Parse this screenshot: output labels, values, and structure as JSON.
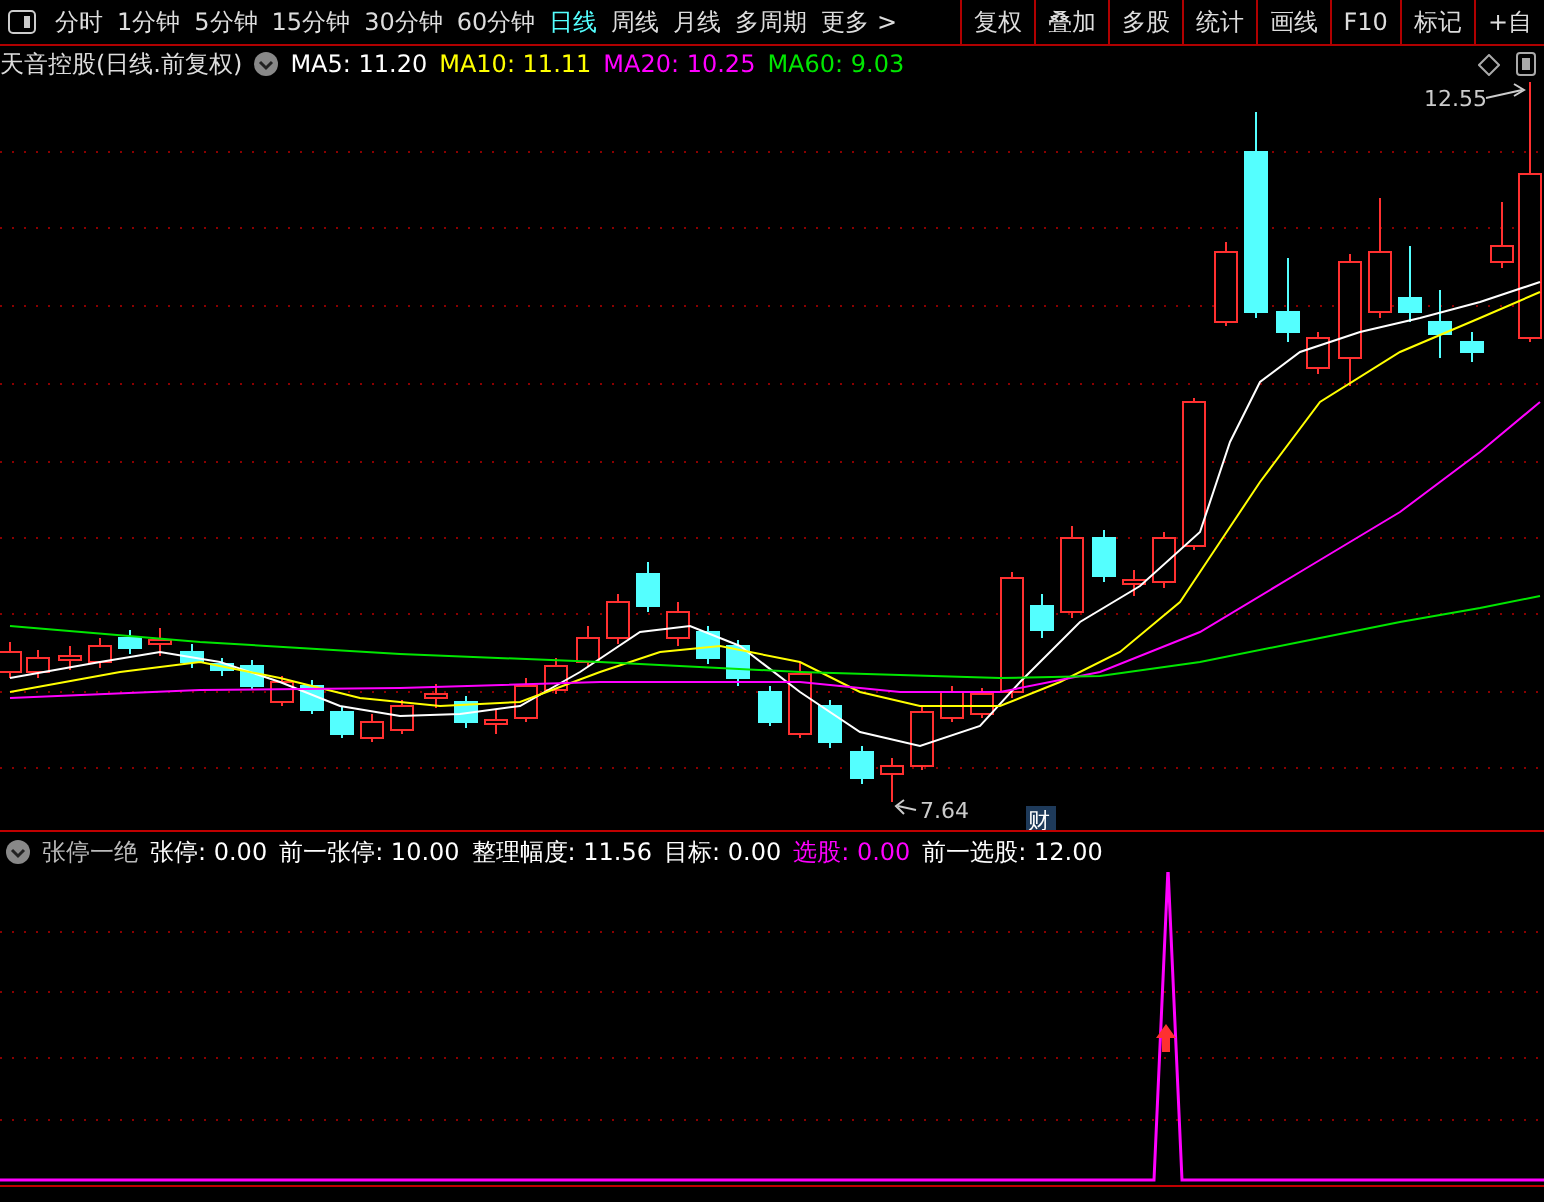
{
  "toolbar": {
    "periods": [
      {
        "label": "分时",
        "selected": false
      },
      {
        "label": "1分钟",
        "selected": false
      },
      {
        "label": "5分钟",
        "selected": false
      },
      {
        "label": "15分钟",
        "selected": false
      },
      {
        "label": "30分钟",
        "selected": false
      },
      {
        "label": "60分钟",
        "selected": false
      },
      {
        "label": "日线",
        "selected": true
      },
      {
        "label": "周线",
        "selected": false
      },
      {
        "label": "月线",
        "selected": false
      },
      {
        "label": "多周期",
        "selected": false
      },
      {
        "label": "更多 >",
        "selected": false
      }
    ],
    "buttons": [
      "复权",
      "叠加",
      "多股",
      "统计",
      "画线",
      "F10",
      "标记",
      "+自"
    ]
  },
  "chart": {
    "title": "天音控股(日线.前复权)",
    "indicators": [
      {
        "label": "MA5: 11.20",
        "color": "#ffffff"
      },
      {
        "label": "MA10: 11.11",
        "color": "#ffff00"
      },
      {
        "label": "MA20: 10.25",
        "color": "#ff00ff"
      },
      {
        "label": "MA60: 9.03",
        "color": "#00e600"
      }
    ],
    "high_label": "12.55",
    "low_label": "7.64",
    "event_badge": "财"
  },
  "indicator_panel": {
    "name": "张停一绝",
    "fields": [
      {
        "label": "张停: 0.00",
        "color": "#ffffff"
      },
      {
        "label": "前一张停: 10.00",
        "color": "#ffffff"
      },
      {
        "label": "整理幅度: 11.56",
        "color": "#ffffff"
      },
      {
        "label": "目标: 0.00",
        "color": "#ffffff"
      },
      {
        "label": "选股: 0.00",
        "color": "#ff00ff"
      },
      {
        "label": "前一选股: 12.00",
        "color": "#ffffff"
      }
    ]
  }
}
